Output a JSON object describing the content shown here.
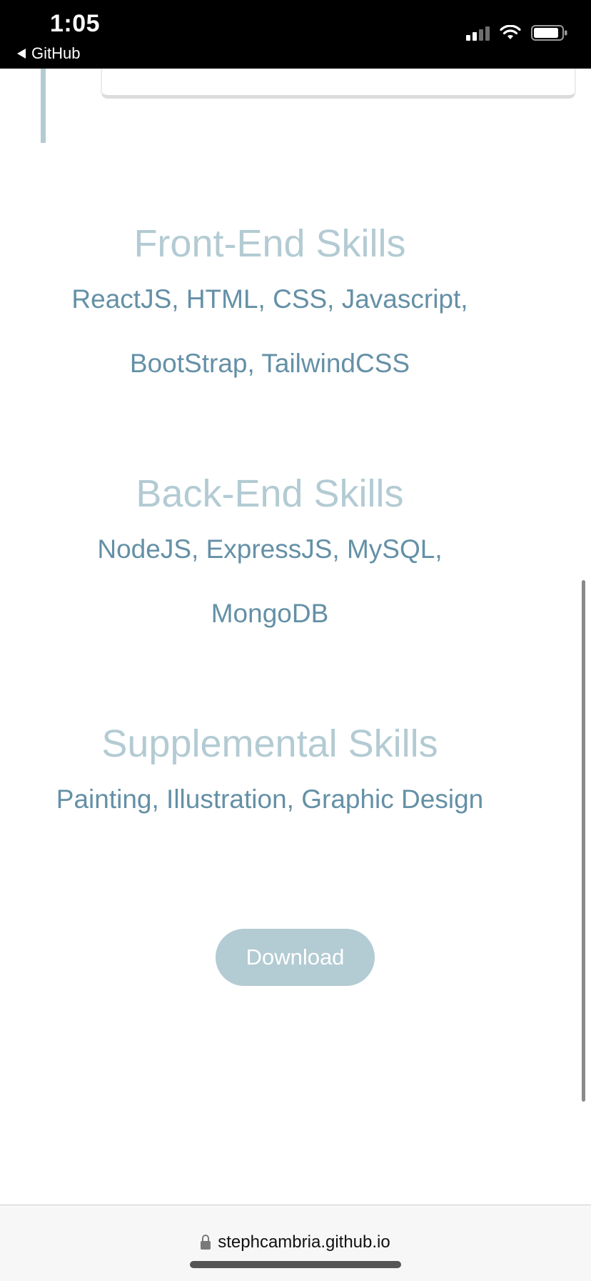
{
  "status_bar": {
    "time": "1:05",
    "back_label": "GitHub",
    "icons": [
      "back-arrow-icon",
      "cellular-signal-icon",
      "wifi-icon",
      "battery-icon"
    ]
  },
  "sections": [
    {
      "title": "Front-End Skills",
      "lines": [
        "ReactJS, HTML, CSS, Javascript,",
        "BootStrap, TailwindCSS"
      ]
    },
    {
      "title": "Back-End Skills",
      "lines": [
        "NodeJS, ExpressJS, MySQL,",
        "MongoDB"
      ]
    },
    {
      "title": "Supplemental Skills",
      "lines": [
        "Painting, Illustration, Graphic Design"
      ]
    }
  ],
  "download_button": {
    "label": "Download"
  },
  "address_bar": {
    "url": "stephcambria.github.io"
  },
  "colors": {
    "heading": "#b3cbd3",
    "skill_text": "#6490a6",
    "button_bg": "#b3cbd3",
    "status_bar_bg": "#000000"
  }
}
